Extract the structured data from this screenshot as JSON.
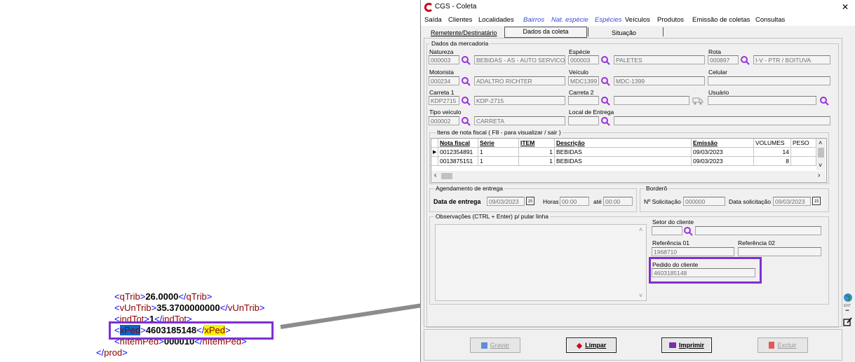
{
  "xml": {
    "l1": {
      "open": "qTrib",
      "value": "26.0000",
      "close": "qTrib"
    },
    "l2": {
      "open": "vUnTrib",
      "value": "35.3700000000",
      "close": "vUnTrib"
    },
    "l3": {
      "open": "indTot",
      "value": "1",
      "close": "indTot"
    },
    "l4": {
      "open": "xPed",
      "value": "4603185148",
      "close": "xPed"
    },
    "l5": {
      "open": "nItemPed",
      "value": "000010",
      "close": "nItemPed"
    },
    "l6": {
      "close": "prod"
    }
  },
  "window": {
    "title": "CGS - Coleta",
    "close_glyph": "✕",
    "menu": [
      "Saída",
      "Clientes",
      "Localidades",
      "Bairros",
      "Nat. espécie",
      "Espécies",
      "Veículos",
      "Produtos",
      "Emissão de coletas",
      "Consultas"
    ],
    "tabs": [
      "Remetente/Destinatário",
      "Dados da coleta",
      "Situação"
    ]
  },
  "mercadoria": {
    "title": "Dados da mercadoria",
    "natureza": {
      "label": "Natureza",
      "code": "000003",
      "desc": "BEBIDAS - AS - AUTO SERVICO"
    },
    "especie": {
      "label": "Espécie",
      "code": "000003",
      "desc": "PALETES"
    },
    "rota": {
      "label": "Rota",
      "code": "000897",
      "desc": "I-V - PTR / BOITUVA"
    },
    "motorista": {
      "label": "Motorista",
      "code": "000234",
      "desc": "ADALTRO RICHTER"
    },
    "veiculo": {
      "label": "Veículo",
      "code": "MDC1399",
      "desc": "MDC-1399"
    },
    "celular": {
      "label": "Celular",
      "value": ""
    },
    "carreta1": {
      "label": "Carreta 1",
      "code": "KDP2715",
      "desc": "KDP-2715"
    },
    "carreta2": {
      "label": "Carreta 2",
      "code": "",
      "desc": ""
    },
    "usuario": {
      "label": "Usuário",
      "value": ""
    },
    "tipo_veiculo": {
      "label": "Tipo veículo",
      "code": "000002",
      "desc": "CARRETA"
    },
    "local_entrega": {
      "label": "Local de Entrega",
      "code": "",
      "desc": ""
    }
  },
  "itens": {
    "title": "Itens de nota fiscal ( F8 - para visualizar / sair )",
    "headers": [
      "Nota fiscal",
      "Série",
      "ITEM",
      "Descrição",
      "Emissão",
      "VOLUMES",
      "PESO"
    ],
    "rows": [
      [
        "0012354891",
        "1",
        "1",
        "BEBIDAS",
        "09/03/2023",
        "14",
        ""
      ],
      [
        "0013875151",
        "1",
        "1",
        "BEBIDAS",
        "09/03/2023",
        "8",
        ""
      ]
    ]
  },
  "agendamento": {
    "title": "Agendamento de entrega",
    "data_label": "Data de entrega",
    "data_value": "09/03/2023",
    "horas_label": "Horas",
    "horas_from": "00:00",
    "ate_label": "até",
    "horas_to": "00:00"
  },
  "bordero": {
    "title": "Borderô",
    "solicitacao_label": "Nº Solicitação",
    "solicitacao_value": "000000",
    "data_label": "Data solicitação",
    "data_value": "09/03/2023"
  },
  "observacoes": {
    "title": "Observações (CTRL + Enter) p/ pular linha",
    "setor_label": "Setor do cliente",
    "ref1_label": "Referência 01",
    "ref1_value": "1968710",
    "ref2_label": "Referência 02",
    "ref2_value": "",
    "pedido_label": "Pedido do cliente",
    "pedido_value": "4603185148"
  },
  "buttons": {
    "gravar": "Gravar",
    "limpar": "Limpar",
    "imprimir": "Imprimir",
    "excluir": "Excluir"
  },
  "colors": {
    "highlight_box": "#7e2fd4",
    "arrow": "#8c8c8c",
    "selection": "#0a66c9",
    "yellow": "#f4f400"
  }
}
